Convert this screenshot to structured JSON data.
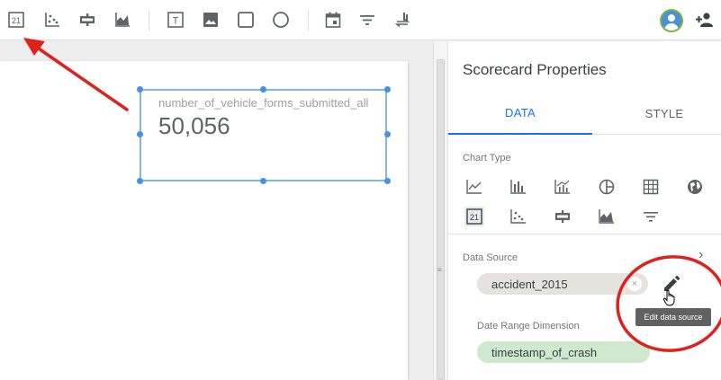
{
  "toolbar": {
    "icons": [
      "scorecard-icon",
      "scatter-chart-icon",
      "bullet-chart-icon",
      "area-chart-icon",
      "text-icon",
      "image-icon",
      "rectangle-icon",
      "circle-icon",
      "date-range-icon",
      "filter-icon",
      "data-control-icon",
      "avatar-icon",
      "add-person-icon"
    ],
    "scorecard_glyph": "21",
    "text_glyph": "T"
  },
  "scorecard": {
    "metric": "number_of_vehicle_forms_submitted_all",
    "value": "50,056"
  },
  "panel": {
    "title": "Scorecard Properties",
    "tabs": [
      {
        "label": "DATA",
        "selected": true
      },
      {
        "label": "STYLE",
        "selected": false
      }
    ],
    "chart_type_label": "Chart Type",
    "data_source_label": "Data Source",
    "data_source": "accident_2015",
    "date_range_label": "Date Range Dimension",
    "date_range_dimension": "timestamp_of_crash",
    "edit_tooltip": "Edit data source",
    "selected_chart_glyph": "21"
  },
  "colors": {
    "accent": "#1a73e8",
    "annotation": "#e0201c",
    "selection": "#7fb8e6",
    "data_source_chip": "#e6e3de",
    "dimension_chip": "#cfe8cf"
  }
}
